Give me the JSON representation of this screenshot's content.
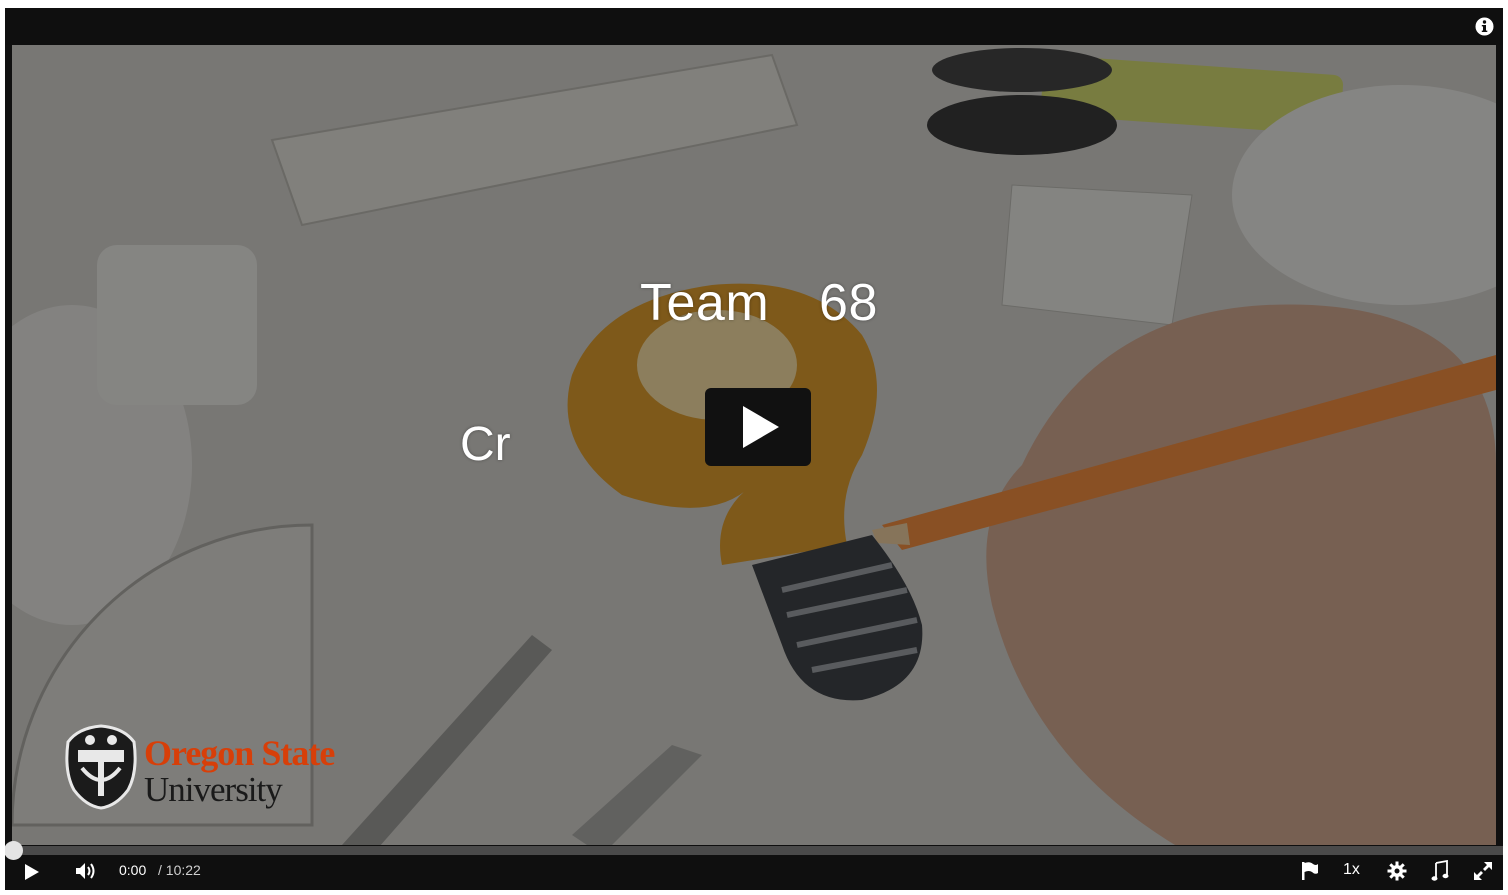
{
  "video": {
    "title_line": "Team  68",
    "subtitle_fragment": "Cr",
    "logo_line1": "Oregon State",
    "logo_line2": "University"
  },
  "player": {
    "current_time": "0:00",
    "duration": "/ 10:22",
    "progress_fraction": 0.0,
    "speed_label": "1x"
  },
  "icons": {
    "info": "info-icon",
    "big_play": "play-icon",
    "play": "play-icon",
    "volume": "volume-icon",
    "flag": "flag-icon",
    "settings": "gear-icon",
    "audio": "music-note-icon",
    "fullscreen": "fullscreen-icon"
  },
  "colors": {
    "brand_orange": "#d73f09",
    "chrome": "#0f0f0f"
  }
}
